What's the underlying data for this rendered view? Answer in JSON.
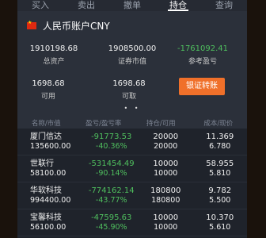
{
  "tabs": [
    {
      "label": "买入",
      "active": false
    },
    {
      "label": "卖出",
      "active": false
    },
    {
      "label": "撤单",
      "active": false
    },
    {
      "label": "持仓",
      "active": true
    },
    {
      "label": "查询",
      "active": false
    }
  ],
  "account": {
    "title": "人民币账户CNY",
    "total_assets": {
      "value": "1910198.68",
      "label": "总资产"
    },
    "market_value": {
      "value": "1908500.00",
      "label": "证券市值"
    },
    "reference_pl": {
      "value": "-1761092.41",
      "label": "参考盈亏"
    },
    "available": {
      "value": "1698.68",
      "label": "可用"
    },
    "withdrawable": {
      "value": "1698.68",
      "label": "可取"
    },
    "transfer_button": "银证转账",
    "page_dots": "• •"
  },
  "table": {
    "headers": [
      "名称/市值",
      "盈亏/盈亏率",
      "持仓/可用",
      "成本/现价"
    ],
    "rows": [
      {
        "name": "厦门信达",
        "market_value": "135600.00",
        "pl": "-91773.53",
        "pl_rate": "-40.36%",
        "position": "20000",
        "available": "20000",
        "cost": "11.369",
        "price": "6.780"
      },
      {
        "name": "世联行",
        "market_value": "58100.00",
        "pl": "-531454.49",
        "pl_rate": "-90.14%",
        "position": "10000",
        "available": "10000",
        "cost": "58.955",
        "price": "5.810"
      },
      {
        "name": "华软科技",
        "market_value": "994400.00",
        "pl": "-774162.14",
        "pl_rate": "-43.77%",
        "position": "180800",
        "available": "180800",
        "cost": "9.782",
        "price": "5.500"
      },
      {
        "name": "宝馨科技",
        "market_value": "56100.00",
        "pl": "-47595.63",
        "pl_rate": "-45.90%",
        "position": "10000",
        "available": "10000",
        "cost": "10.370",
        "price": "5.610"
      }
    ]
  },
  "colors": {
    "negative": "#4fbf5e",
    "accent": "#f0702a"
  }
}
